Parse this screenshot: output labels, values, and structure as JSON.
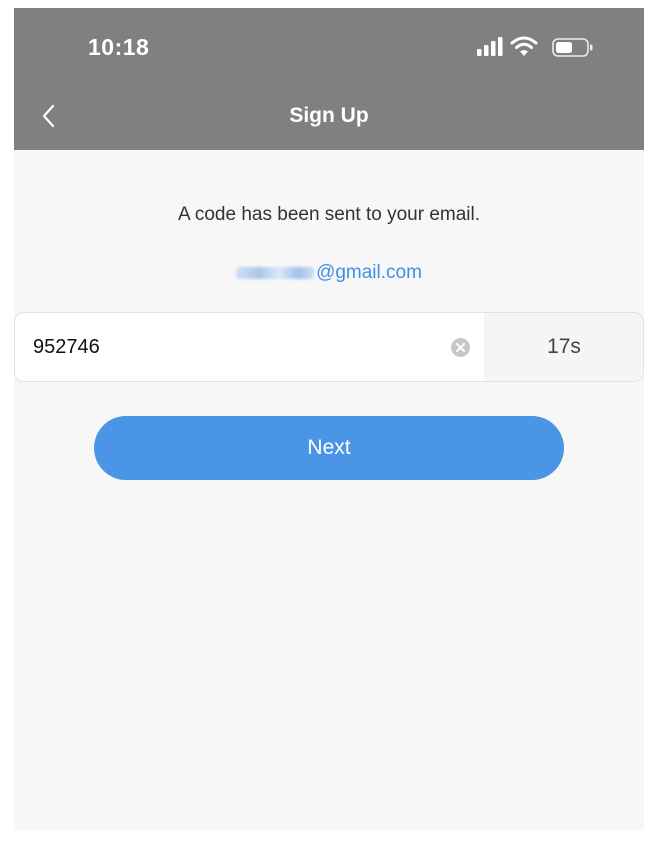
{
  "status_bar": {
    "time": "10:18"
  },
  "nav": {
    "title": "Sign Up",
    "back_icon": "chevron-left-icon"
  },
  "verification": {
    "message": "A code has been sent to your email.",
    "email_suffix": "@gmail.com",
    "code_value": "952746",
    "countdown": "17s",
    "next_label": "Next"
  },
  "colors": {
    "header_bg": "#808080",
    "page_bg": "#f7f7f7",
    "link_blue": "#3f8ee6",
    "button_blue": "#4a95e5"
  },
  "icons": [
    "signal-icon",
    "wifi-icon",
    "battery-icon",
    "chevron-left-icon",
    "clear-icon"
  ]
}
